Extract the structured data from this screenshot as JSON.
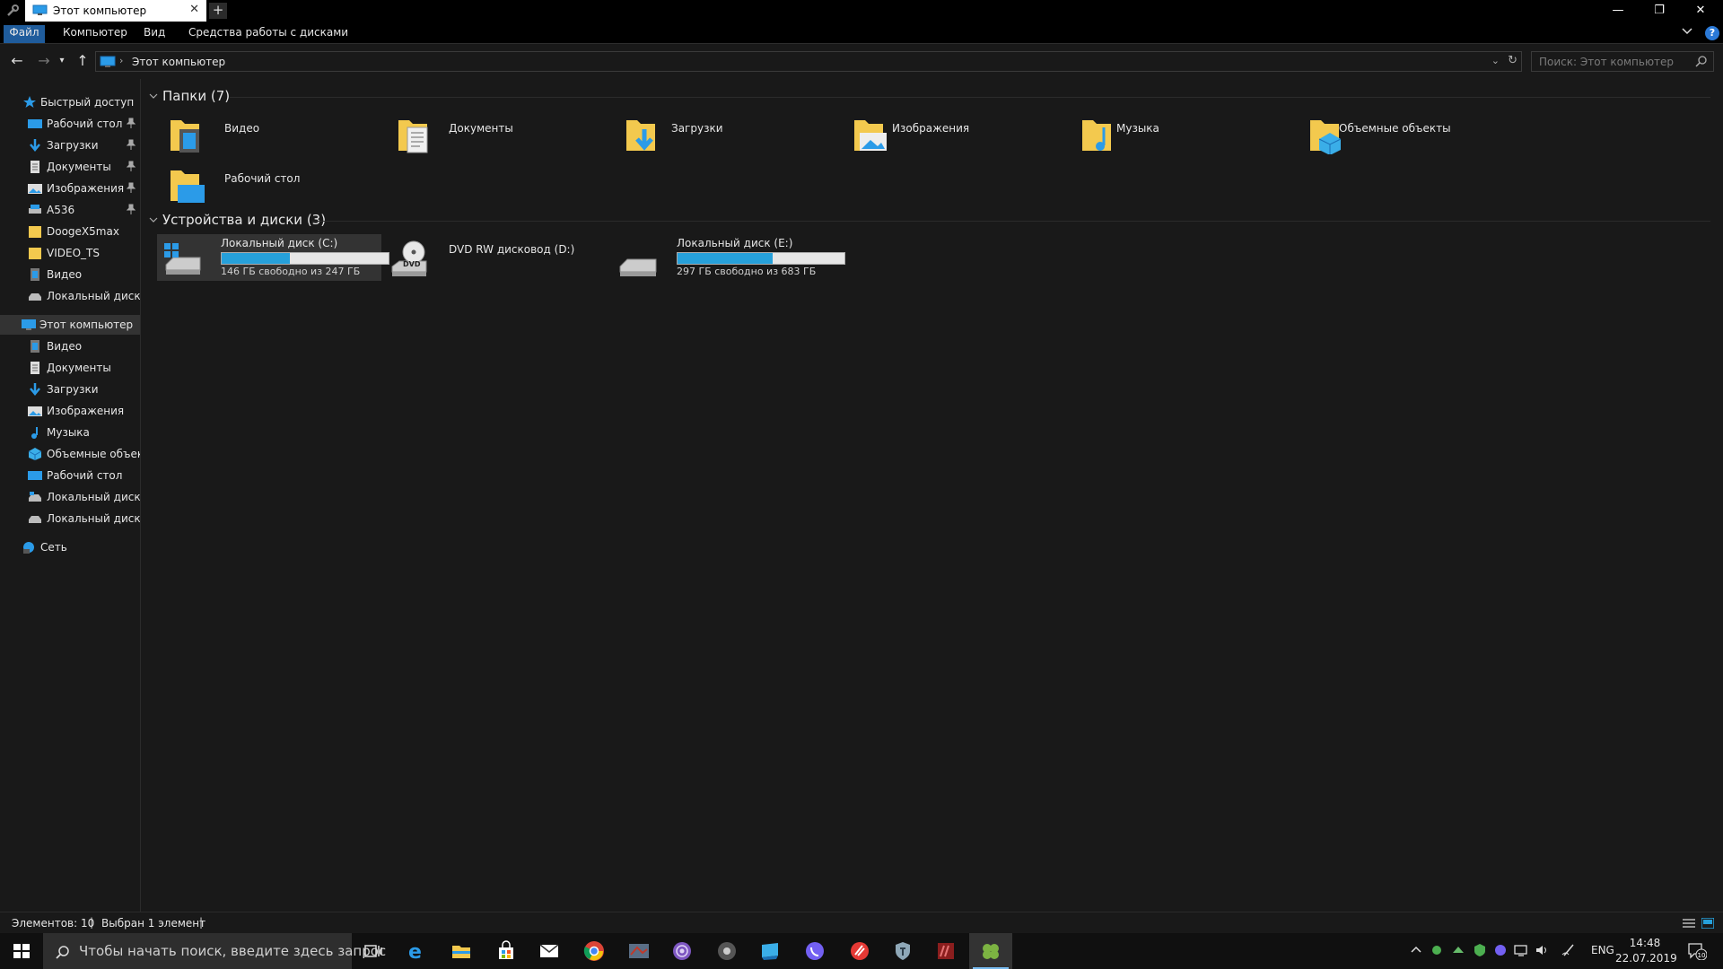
{
  "window": {
    "tab_title": "Этот компьютер",
    "new_tab_label": "+",
    "tab_close": "✕",
    "minimize": "—",
    "restore": "❐",
    "close": "✕"
  },
  "ribbon": {
    "tabs": [
      "Файл",
      "Компьютер",
      "Вид",
      "Средства работы с дисками"
    ],
    "help": "?"
  },
  "address": {
    "breadcrumb": "Этот компьютер",
    "search_placeholder": "Поиск: Этот компьютер"
  },
  "nav": {
    "quick_access": "Быстрый доступ",
    "quick_items": [
      {
        "label": "Рабочий стол",
        "icon": "desktop-icon",
        "pinned": true
      },
      {
        "label": "Загрузки",
        "icon": "downloads-icon",
        "pinned": true
      },
      {
        "label": "Документы",
        "icon": "documents-icon",
        "pinned": true
      },
      {
        "label": "Изображения",
        "icon": "pictures-icon",
        "pinned": true
      },
      {
        "label": "A536",
        "icon": "drive-icon",
        "pinned": true
      },
      {
        "label": "DoogeX5max",
        "icon": "folder-icon",
        "pinned": false
      },
      {
        "label": "VIDEO_TS",
        "icon": "folder-icon",
        "pinned": false
      },
      {
        "label": "Видео",
        "icon": "video-icon",
        "pinned": false
      },
      {
        "label": "Локальный диск (E",
        "icon": "drive-icon",
        "pinned": false
      }
    ],
    "this_pc": "Этот компьютер",
    "pc_items": [
      {
        "label": "Видео",
        "icon": "video-icon"
      },
      {
        "label": "Документы",
        "icon": "documents-icon"
      },
      {
        "label": "Загрузки",
        "icon": "downloads-icon"
      },
      {
        "label": "Изображения",
        "icon": "pictures-icon"
      },
      {
        "label": "Музыка",
        "icon": "music-icon"
      },
      {
        "label": "Объемные объекты",
        "icon": "3d-objects-icon"
      },
      {
        "label": "Рабочий стол",
        "icon": "desktop-icon"
      },
      {
        "label": "Локальный диск (C",
        "icon": "drive-icon"
      },
      {
        "label": "Локальный диск (E",
        "icon": "drive-icon"
      }
    ],
    "network": "Сеть"
  },
  "content": {
    "folders_header": "Папки (7)",
    "folders": [
      {
        "label": "Видео",
        "icon": "video-folder-icon"
      },
      {
        "label": "Документы",
        "icon": "documents-folder-icon"
      },
      {
        "label": "Загрузки",
        "icon": "downloads-folder-icon"
      },
      {
        "label": "Изображения",
        "icon": "pictures-folder-icon"
      },
      {
        "label": "Музыка",
        "icon": "music-folder-icon"
      },
      {
        "label": "Объемные объекты",
        "icon": "3d-objects-folder-icon"
      },
      {
        "label": "Рабочий стол",
        "icon": "desktop-folder-icon"
      }
    ],
    "devices_header": "Устройства и диски (3)",
    "drives": [
      {
        "name": "Локальный диск (C:)",
        "free": "146 ГБ свободно из 247 ГБ",
        "used_fraction": 0.41,
        "selected": true,
        "icon": "windows-drive-icon"
      },
      {
        "name": "DVD RW дисковод (D:)",
        "free": "",
        "used_fraction": null,
        "selected": false,
        "icon": "dvd-drive-icon"
      },
      {
        "name": "Локальный диск (E:)",
        "free": "297 ГБ свободно из 683 ГБ",
        "used_fraction": 0.57,
        "selected": false,
        "icon": "drive-icon"
      }
    ]
  },
  "status": {
    "items": "Элементов: 10",
    "selected": "Выбран 1 элемент",
    "sep": "|"
  },
  "taskbar": {
    "search_placeholder": "Чтобы начать поиск, введите здесь запрос",
    "apps": [
      "task-view-icon",
      "edge-icon",
      "file-explorer-icon",
      "store-icon",
      "mail-icon",
      "chrome-icon",
      "game-icon",
      "tor-browser-icon",
      "media-icon",
      "screen-icon",
      "viber-icon",
      "opera-icon",
      "shield-icon",
      "winrar-icon",
      "clover-icon"
    ],
    "lang": "ENG",
    "time": "14:48",
    "date": "22.07.2019",
    "notif_count": "10"
  },
  "colors": {
    "accent": "#26a0da",
    "file_tab": "#1f5c9c",
    "background": "#191919"
  }
}
